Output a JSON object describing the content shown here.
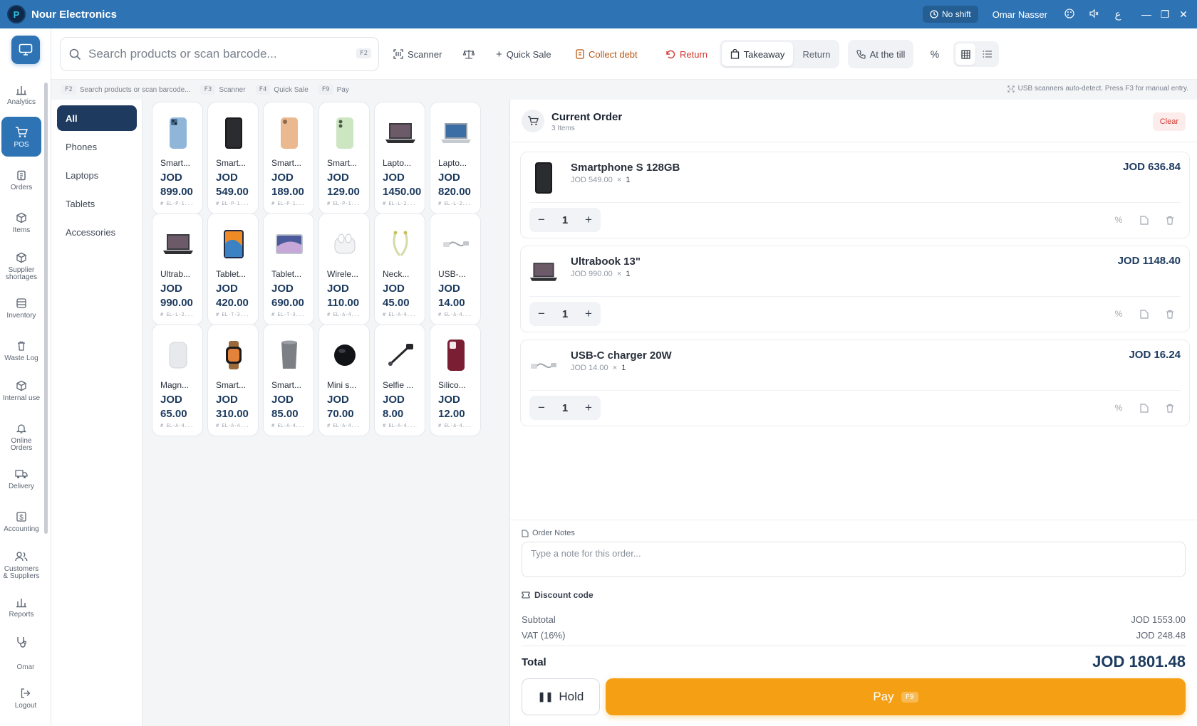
{
  "app": {
    "title": "Nour Electronics",
    "logo_letter": "P"
  },
  "titlebar": {
    "shift_status": "No shift",
    "user": "Omar Nasser"
  },
  "nav": {
    "items": [
      {
        "label": "Analytics",
        "icon": "bar-chart-icon"
      },
      {
        "label": "POS",
        "icon": "cart-icon",
        "active": true
      },
      {
        "label": "Orders",
        "icon": "clipboard-icon"
      },
      {
        "label": "Items",
        "icon": "box-icon"
      },
      {
        "label": "Supplier shortages",
        "icon": "box-alert-icon"
      },
      {
        "label": "Inventory",
        "icon": "database-icon"
      },
      {
        "label": "Waste Log",
        "icon": "trash-icon"
      },
      {
        "label": "Internal use",
        "icon": "box-icon"
      },
      {
        "label": "Online Orders",
        "icon": "bell-icon"
      },
      {
        "label": "Delivery",
        "icon": "truck-icon"
      },
      {
        "label": "Accounting",
        "icon": "dollar-icon"
      },
      {
        "label": "Customers & Suppliers",
        "icon": "users-icon"
      },
      {
        "label": "Reports",
        "icon": "bar-chart-icon"
      }
    ],
    "user": "Omar",
    "logout": "Logout"
  },
  "toolbar": {
    "search_placeholder": "Search products or scan barcode...",
    "search_key": "F2",
    "scanner": "Scanner",
    "quick_sale": "Quick Sale",
    "collect_debt": "Collect debt",
    "return": "Return",
    "order_type_takeaway": "Takeaway",
    "order_type_return": "Return",
    "at_till": "At the till",
    "percent": "%"
  },
  "hints": {
    "items": [
      {
        "key": "F2",
        "label": "Search products or scan barcode..."
      },
      {
        "key": "F3",
        "label": "Scanner"
      },
      {
        "key": "F4",
        "label": "Quick Sale"
      },
      {
        "key": "F9",
        "label": "Pay"
      }
    ],
    "right": "USB scanners auto-detect. Press F3 for manual entry."
  },
  "categories": [
    "All",
    "Phones",
    "Laptops",
    "Tablets",
    "Accessories"
  ],
  "products": [
    {
      "name": "Smart...",
      "price": "JOD\n899.00",
      "sku": "# EL-P-1...",
      "icon": "phone-blue"
    },
    {
      "name": "Smart...",
      "price": "JOD\n549.00",
      "sku": "# EL-P-1...",
      "icon": "phone-black"
    },
    {
      "name": "Smart...",
      "price": "JOD\n189.00",
      "sku": "# EL-P-1...",
      "icon": "phone-gold"
    },
    {
      "name": "Smart...",
      "price": "JOD\n129.00",
      "sku": "# EL-P-1...",
      "icon": "phone-green"
    },
    {
      "name": "Lapto...",
      "price": "JOD\n1450.00",
      "sku": "# EL-L-2...",
      "icon": "laptop-dark"
    },
    {
      "name": "Lapto...",
      "price": "JOD\n820.00",
      "sku": "# EL-L-2...",
      "icon": "laptop-silver"
    },
    {
      "name": "Ultrab...",
      "price": "JOD\n990.00",
      "sku": "# EL-L-2...",
      "icon": "laptop-dark"
    },
    {
      "name": "Tablet...",
      "price": "JOD\n420.00",
      "sku": "# EL-T-3...",
      "icon": "tablet-color"
    },
    {
      "name": "Tablet...",
      "price": "JOD\n690.00",
      "sku": "# EL-T-3...",
      "icon": "tablet-silver"
    },
    {
      "name": "Wirele...",
      "price": "JOD\n110.00",
      "sku": "# EL-A-4...",
      "icon": "earbuds"
    },
    {
      "name": "Neck...",
      "price": "JOD\n45.00",
      "sku": "# EL-A-4...",
      "icon": "neckband"
    },
    {
      "name": "USB-...",
      "price": "JOD\n14.00",
      "sku": "# EL-A-4...",
      "icon": "cable"
    },
    {
      "name": "Magn...",
      "price": "JOD\n65.00",
      "sku": "# EL-A-4...",
      "icon": "powerbank"
    },
    {
      "name": "Smart...",
      "price": "JOD\n310.00",
      "sku": "# EL-A-4...",
      "icon": "watch"
    },
    {
      "name": "Smart...",
      "price": "JOD\n85.00",
      "sku": "# EL-A-4...",
      "icon": "speaker"
    },
    {
      "name": "Mini s...",
      "price": "JOD\n70.00",
      "sku": "# EL-A-4...",
      "icon": "mini-speaker"
    },
    {
      "name": "Selfie ...",
      "price": "JOD\n8.00",
      "sku": "# EL-A-4...",
      "icon": "selfie-stick"
    },
    {
      "name": "Silico...",
      "price": "JOD\n12.00",
      "sku": "# EL-A-4...",
      "icon": "phone-case"
    }
  ],
  "order": {
    "title": "Current Order",
    "count": "3 Items",
    "clear": "Clear",
    "items": [
      {
        "name": "Smartphone S 128GB",
        "unit_price": "JOD 549.00",
        "times": "×",
        "qty": "1",
        "total": "JOD 636.84",
        "icon": "phone-black"
      },
      {
        "name": "Ultrabook 13\"",
        "unit_price": "JOD 990.00",
        "times": "×",
        "qty": "1",
        "total": "JOD 1148.40",
        "icon": "laptop-dark"
      },
      {
        "name": "USB-C charger 20W",
        "unit_price": "JOD 14.00",
        "times": "×",
        "qty": "1",
        "total": "JOD 16.24",
        "icon": "cable"
      }
    ],
    "notes_label": "Order Notes",
    "notes_placeholder": "Type a note for this order...",
    "discount_label": "Discount code",
    "subtotal_label": "Subtotal",
    "subtotal": "JOD 1553.00",
    "vat_label": "VAT (16%)",
    "vat": "JOD 248.48",
    "total_label": "Total",
    "total": "JOD 1801.48",
    "hold": "Hold",
    "pay": "Pay",
    "pay_key": "F9"
  },
  "colors": {
    "brand": "#2e73b4",
    "accent": "#f5a014",
    "navy": "#1e3a5f",
    "danger": "#d2382e"
  }
}
